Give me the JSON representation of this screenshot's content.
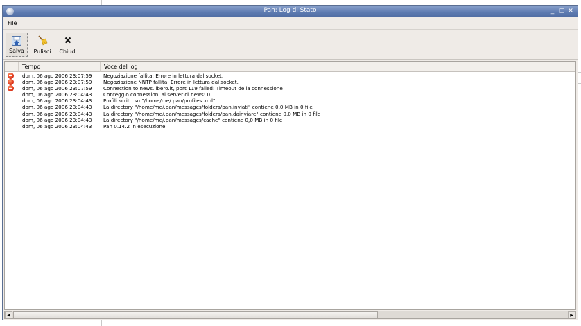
{
  "window": {
    "title": "Pan: Log di Stato"
  },
  "menu": {
    "file_underlined": "F",
    "file_rest": "ile"
  },
  "toolbar": {
    "save_label": "Salva",
    "clear_label": "Pulisci",
    "close_label": "Chiudi"
  },
  "columns": {
    "time": "Tempo",
    "entry": "Voce del log"
  },
  "log": [
    {
      "type": "error",
      "time": "dom, 06 ago 2006 23:07:59",
      "message": "Negoziazione fallita: Errore in lettura dal socket."
    },
    {
      "type": "error",
      "time": "dom, 06 ago 2006 23:07:59",
      "message": "Negoziazione NNTP fallita: Errore in lettura dal socket."
    },
    {
      "type": "error",
      "time": "dom, 06 ago 2006 23:07:59",
      "message": "Connection to news.libero.it, port 119 failed: Timeout della connessione"
    },
    {
      "type": "info",
      "time": "dom, 06 ago 2006 23:04:43",
      "message": "Conteggio connessioni al server di news: 0"
    },
    {
      "type": "info",
      "time": "dom, 06 ago 2006 23:04:43",
      "message": "Profili scritti su \"/home/me/.pan/profiles.xml\""
    },
    {
      "type": "info",
      "time": "dom, 06 ago 2006 23:04:43",
      "message": "La directory \"/home/me/.pan/messages/folders/pan.inviati\" contiene 0,0 MB in 0 file"
    },
    {
      "type": "info",
      "time": "dom, 06 ago 2006 23:04:43",
      "message": "La directory \"/home/me/.pan/messages/folders/pan.dainviare\" contiene 0,0 MB in 0 file"
    },
    {
      "type": "info",
      "time": "dom, 06 ago 2006 23:04:43",
      "message": "La directory \"/home/me/.pan/messages/cache\" contiene 0,0 MB in 0 file"
    },
    {
      "type": "info",
      "time": "dom, 06 ago 2006 23:04:43",
      "message": "Pan 0.14.2 in esecuzione"
    }
  ],
  "icons": {
    "window": "pan-app-icon",
    "minimize": "minimize-icon",
    "maximize": "maximize-icon",
    "close": "close-icon",
    "save": "save-icon",
    "clear": "broom-icon",
    "close_tool": "x-icon",
    "error": "error-icon"
  },
  "colors": {
    "titlebar": "#5d7ab0",
    "error": "#e0341a"
  }
}
